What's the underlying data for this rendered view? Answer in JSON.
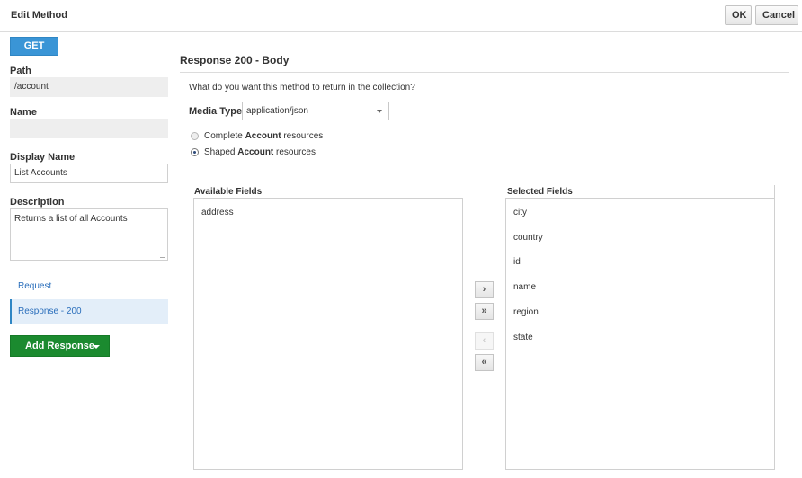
{
  "header": {
    "title": "Edit Method",
    "ok_label": "OK",
    "cancel_label": "Cancel"
  },
  "method": {
    "verb": "GET"
  },
  "form": {
    "path_label": "Path",
    "path_value": "/account",
    "name_label": "Name",
    "name_value": "",
    "display_name_label": "Display Name",
    "display_name_value": "List Accounts",
    "description_label": "Description",
    "description_value": "Returns a list of all Accounts"
  },
  "nav": {
    "items": [
      {
        "label": "Request",
        "active": false
      },
      {
        "label": "Response - 200",
        "active": true
      }
    ],
    "add_response_label": "Add Response"
  },
  "response": {
    "title": "Response 200 - Body",
    "question": "What do you want this method to return in the collection?",
    "media_type_label": "Media Type",
    "media_type_value": "application/json",
    "options": [
      {
        "prefix": "Complete ",
        "bold": "Account",
        "suffix": " resources",
        "selected": false
      },
      {
        "prefix": "Shaped ",
        "bold": "Account",
        "suffix": " resources",
        "selected": true
      }
    ]
  },
  "fields": {
    "available_title": "Available Fields",
    "available": [
      "address"
    ],
    "selected_title": "Selected Fields",
    "selected": [
      "city",
      "country",
      "id",
      "name",
      "region",
      "state"
    ]
  },
  "move_buttons": {
    "add_one": "›",
    "add_all": "»",
    "remove_one": "‹",
    "remove_all": "«"
  }
}
